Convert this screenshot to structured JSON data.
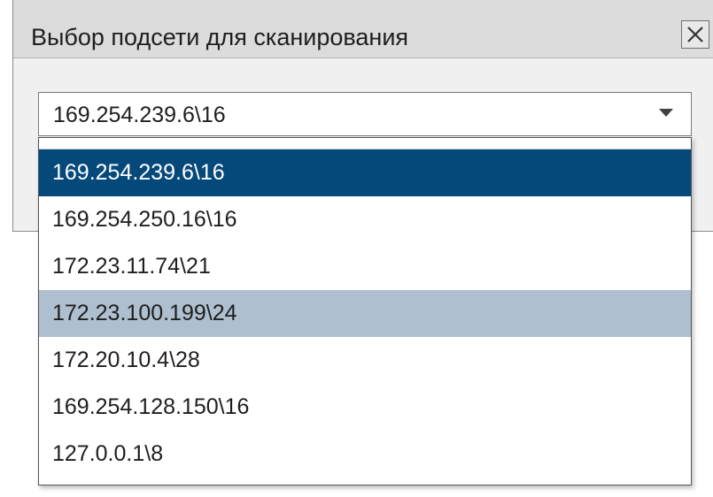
{
  "dialog": {
    "title": "Выбор подсети для сканирования",
    "close_icon": "close-icon"
  },
  "subnet_combo": {
    "value": "169.254.239.6\\16",
    "arrow_icon": "dropdown-arrow-icon"
  },
  "dropdown": {
    "options": [
      {
        "label": "169.254.239.6\\16",
        "state": "selected"
      },
      {
        "label": "169.254.250.16\\16",
        "state": "normal"
      },
      {
        "label": "172.23.11.74\\21",
        "state": "normal"
      },
      {
        "label": "172.23.100.199\\24",
        "state": "hover"
      },
      {
        "label": "172.20.10.4\\28",
        "state": "normal"
      },
      {
        "label": "169.254.128.150\\16",
        "state": "normal"
      },
      {
        "label": "127.0.0.1\\8",
        "state": "normal"
      }
    ]
  },
  "colors": {
    "selected_bg": "#05487a",
    "hover_bg": "#aebfcf",
    "titlebar_bg": "#dcdcdc",
    "dialog_bg": "#f0f0f0"
  }
}
